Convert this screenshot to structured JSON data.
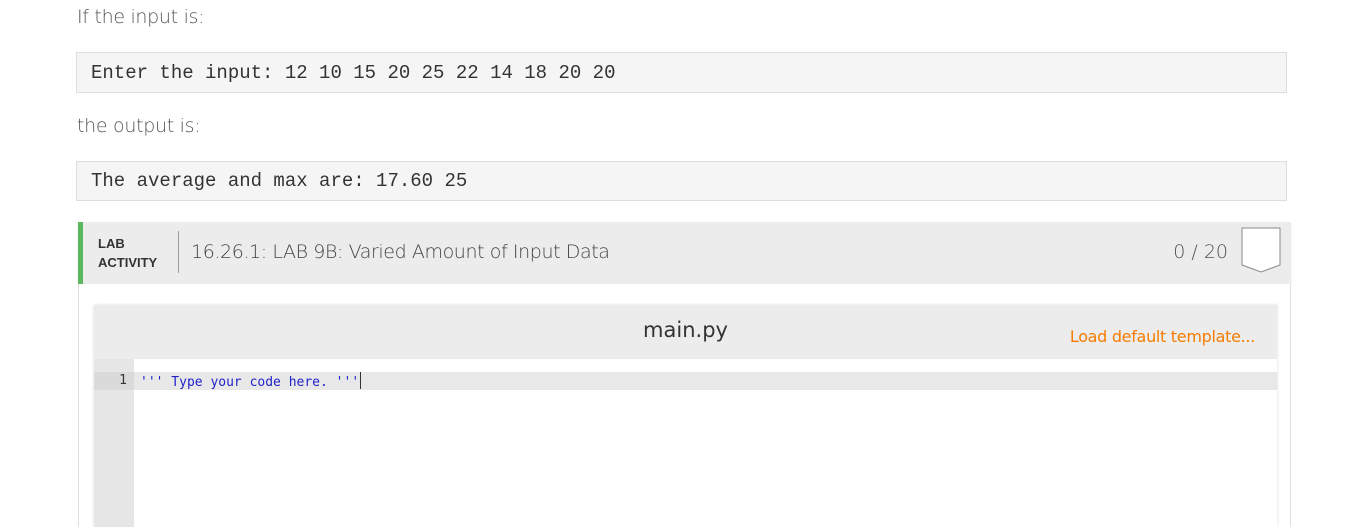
{
  "prose": {
    "input_intro": "If the input is:",
    "output_intro": "the output is:"
  },
  "examples": {
    "input_text": "Enter the input: 12 10 15 20 25 22 14 18 20 20",
    "output_text": "The average and max are: 17.60 25"
  },
  "lab": {
    "tag_line1": "LAB",
    "tag_line2": "ACTIVITY",
    "title": "16.26.1: LAB 9B: Varied Amount of Input Data",
    "score": "0 / 20",
    "score_fraction": 0,
    "accent_color": "#5cb85c"
  },
  "editor": {
    "filename": "main.py",
    "load_template_label": "Load default template...",
    "link_color": "#f57c00",
    "lines": [
      {
        "number": "1",
        "text": "''' Type your code here. '''"
      }
    ]
  }
}
